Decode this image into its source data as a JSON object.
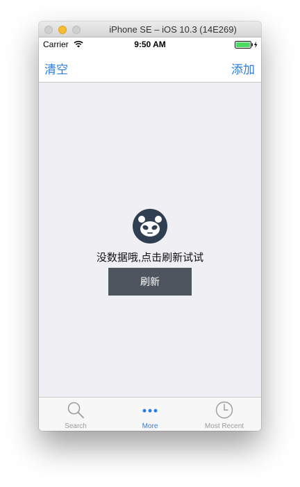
{
  "window": {
    "title": "iPhone SE – iOS 10.3 (14E269)"
  },
  "status_bar": {
    "carrier": "Carrier",
    "time": "9:50 AM",
    "icons": [
      "wifi-icon",
      "battery-icon"
    ]
  },
  "nav_bar": {
    "left_label": "清空",
    "right_label": "添加"
  },
  "empty_state": {
    "icon": "panda-icon",
    "message": "没数据哦,点击刷新试试",
    "button_label": "刷新"
  },
  "tab_bar": {
    "tabs": [
      {
        "label": "Search",
        "icon": "search-icon",
        "active": false
      },
      {
        "label": "More",
        "icon": "more-icon",
        "active": true
      },
      {
        "label": "Most Recent",
        "icon": "clock-icon",
        "active": false
      }
    ]
  },
  "colors": {
    "tint": "#2a7ee0",
    "background": "#efeff4",
    "button": "#4e555e",
    "battery": "#4cd964"
  }
}
